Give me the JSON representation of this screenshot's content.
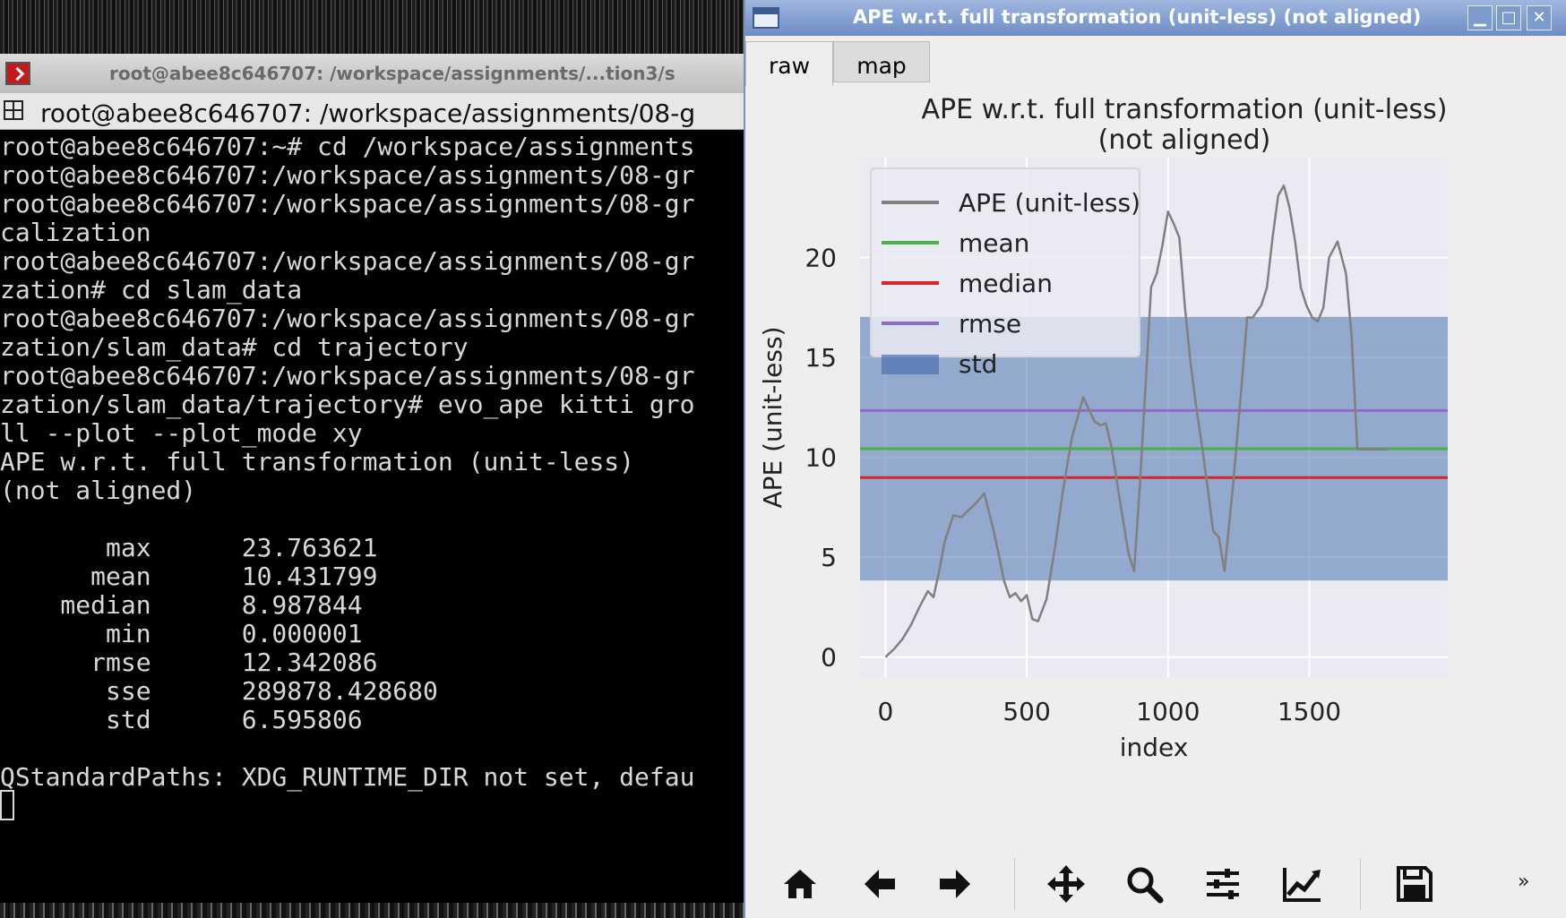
{
  "terminal": {
    "window_title": "root@abee8c646707: /workspace/assignments/...tion3/s",
    "tab_title": "root@abee8c646707: /workspace/assignments/08-g",
    "lines": [
      "root@abee8c646707:~# cd /workspace/assignments",
      "root@abee8c646707:/workspace/assignments/08-gr",
      "root@abee8c646707:/workspace/assignments/08-gr",
      "calization",
      "root@abee8c646707:/workspace/assignments/08-gr",
      "zation# cd slam_data",
      "root@abee8c646707:/workspace/assignments/08-gr",
      "zation/slam_data# cd trajectory",
      "root@abee8c646707:/workspace/assignments/08-gr",
      "zation/slam_data/trajectory# evo_ape kitti gro",
      "ll --plot --plot_mode xy",
      "APE w.r.t. full transformation (unit-less)",
      "(not aligned)",
      "",
      "       max      23.763621",
      "      mean      10.431799",
      "    median      8.987844",
      "       min      0.000001",
      "      rmse      12.342086",
      "       sse      289878.428680",
      "       std      6.595806",
      "",
      "QStandardPaths: XDG_RUNTIME_DIR not set, defau"
    ]
  },
  "plot_window": {
    "title": "APE w.r.t. full transformation (unit-less) (not aligned)",
    "controls": {
      "minimize": "▁",
      "maximize": "□",
      "close": "✕"
    },
    "tabs": [
      {
        "label": "raw",
        "active": true
      },
      {
        "label": "map",
        "active": false
      }
    ],
    "toolbar": [
      {
        "name": "home-icon",
        "active": false
      },
      {
        "name": "back-arrow-icon",
        "active": false
      },
      {
        "name": "forward-arrow-icon",
        "active": false
      },
      {
        "name": "pan-icon",
        "active": false
      },
      {
        "name": "zoom-icon",
        "active": false
      },
      {
        "name": "subplots-icon",
        "active": false
      },
      {
        "name": "axes-edit-icon",
        "active": false
      },
      {
        "name": "save-icon",
        "active": false
      }
    ],
    "overflow_label": "»"
  },
  "chart_data": {
    "type": "line",
    "title": "APE w.r.t. full transformation (unit-less)\n(not aligned)",
    "title_lines": [
      "APE w.r.t. full transformation (unit-less)",
      "(not aligned)"
    ],
    "xlabel": "index",
    "ylabel": "APE (unit-less)",
    "xlim": [
      -90,
      1990
    ],
    "ylim": [
      -1,
      25
    ],
    "xticks": [
      0,
      500,
      1000,
      1500
    ],
    "yticks": [
      0,
      5,
      10,
      15,
      20
    ],
    "grid": true,
    "legend_placement": "upper-left",
    "colors": {
      "ape": "#808080",
      "mean": "#4daf4a",
      "median": "#d62728",
      "rmse": "#8e6cc0",
      "std": "#4c72b0",
      "axes_bg": "#eaeaf2"
    },
    "series": [
      {
        "name": "APE (unit-less)",
        "x": [
          0,
          30,
          60,
          90,
          120,
          150,
          170,
          190,
          210,
          240,
          270,
          290,
          320,
          350,
          360,
          380,
          400,
          420,
          440,
          460,
          480,
          500,
          520,
          540,
          570,
          600,
          630,
          660,
          700,
          740,
          760,
          780,
          800,
          830,
          860,
          880,
          900,
          920,
          940,
          960,
          980,
          1000,
          1020,
          1040,
          1060,
          1080,
          1100,
          1120,
          1140,
          1160,
          1180,
          1200,
          1230,
          1260,
          1280,
          1300,
          1330,
          1350,
          1370,
          1390,
          1410,
          1430,
          1450,
          1470,
          1490,
          1510,
          1530,
          1550,
          1570,
          1600,
          1630,
          1650,
          1670,
          1690,
          1710,
          1730,
          1760,
          1780,
          1800,
          1820,
          1840,
          1860,
          1880
        ],
        "y": [
          0.0,
          0.4,
          0.9,
          1.6,
          2.5,
          3.3,
          3.0,
          4.3,
          5.8,
          7.1,
          7.0,
          7.3,
          7.7,
          8.2,
          7.6,
          6.5,
          5.2,
          3.8,
          3.0,
          3.2,
          2.8,
          3.1,
          1.9,
          1.8,
          2.9,
          5.5,
          8.5,
          11.0,
          13.0,
          11.8,
          11.6,
          11.7,
          10.5,
          7.8,
          5.2,
          4.3,
          8.5,
          13.5,
          18.5,
          19.2,
          20.6,
          22.3,
          21.7,
          21.0,
          17.5,
          14.7,
          12.5,
          10.6,
          8.5,
          6.3,
          6.0,
          4.3,
          8.6,
          13.5,
          17.0,
          17.0,
          17.6,
          18.5,
          21.0,
          23.1,
          23.6,
          22.5,
          20.8,
          18.5,
          17.6,
          17.0,
          16.8,
          17.5,
          20.0,
          20.8,
          19.2,
          16.0,
          10.4,
          10.4,
          10.4,
          10.4,
          10.4,
          10.4,
          10.4,
          10.4,
          10.4,
          10.4,
          10.4
        ]
      }
    ],
    "hlines": [
      {
        "name": "mean",
        "value": 10.431799
      },
      {
        "name": "median",
        "value": 8.987844
      },
      {
        "name": "rmse",
        "value": 12.342086
      }
    ],
    "band": {
      "name": "std",
      "center": 10.431799,
      "half_width": 6.595806
    },
    "legend_entries": [
      "APE (unit-less)",
      "mean",
      "median",
      "rmse",
      "std"
    ]
  }
}
